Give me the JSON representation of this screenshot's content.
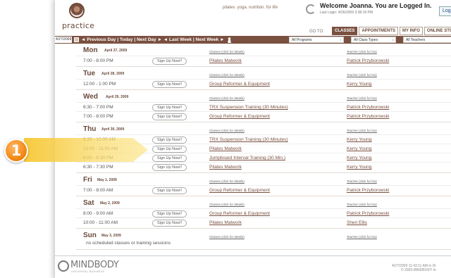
{
  "header": {
    "brand": "practice",
    "tagline": "pilates. yoga. nutrition. for life",
    "welcome": "Welcome Joanna. You are Logged In.",
    "last_login": "Last Login: 4/26/2009 3:38:19 PM",
    "logout_label": "Log Ou",
    "goto_label": "GO TO:",
    "nav_tabs": [
      "CLASSES",
      "APPOINTMENTS",
      "MY INFO",
      "ONLINE STOR"
    ]
  },
  "toolbar": {
    "date": "4/27/2009",
    "nav_text": "◄ Previous Day | Today | Next Day ► ◄ Last Week | Next Week ►",
    "program_filter": "All Programs",
    "class_type_filter": "All Class Types",
    "teacher_filter": "All Teachers"
  },
  "schedule": {
    "class_hint": "Classes (click for details)",
    "teacher_hint": "Teacher (click for bio)",
    "signup_label": "Sign Up Now!!",
    "days": [
      {
        "name": "Mon",
        "date": "April 27, 2009",
        "rows": [
          {
            "time": "7:00 - 8:00 PM",
            "class": "Pilates Matwork",
            "teacher": "Patrick Przyborowski"
          }
        ]
      },
      {
        "name": "Tue",
        "date": "April 28, 2009",
        "rows": [
          {
            "time": "12:00 - 1:00 PM",
            "class": "Group Reformer & Equipment",
            "teacher": "Kerry Young"
          }
        ]
      },
      {
        "name": "Wed",
        "date": "April 29, 2009",
        "rows": [
          {
            "time": "6:30 - 7:00 PM",
            "class": "TRX Suspension Training (30 Minutes)",
            "teacher": "Patrick Przyborowski"
          },
          {
            "time": "7:00 - 8:00 PM",
            "class": "Group Reformer & Equipment",
            "teacher": "Patrick Przyborowski"
          }
        ]
      },
      {
        "name": "Thu",
        "date": "April 30, 2009",
        "rows": [
          {
            "time": "6:30 - 10:00 AM",
            "class": "TRX Suspension Training (30 Minutes)",
            "teacher": "Kerry Young"
          },
          {
            "time": "10:00 - 11:00 AM",
            "class": "Pilates Matwork",
            "teacher": "Kerry Young"
          },
          {
            "time": "6:00 - 6:30 PM",
            "class": "Jumpboard Interval Training (30 Min.)",
            "teacher": "Kerry Young"
          },
          {
            "time": "6:30 - 7:30 PM",
            "class": "Pilates Matwork",
            "teacher": "Kerry Young"
          }
        ]
      },
      {
        "name": "Fri",
        "date": "May 1, 2009",
        "rows": [
          {
            "time": "7:00 - 8:00 AM",
            "class": "Group Reformer & Equipment",
            "teacher": "Patrick Przyborowski"
          }
        ]
      },
      {
        "name": "Sat",
        "date": "May 2, 2009",
        "rows": [
          {
            "time": "8:00 - 9:00 AM",
            "class": "Group Reformer & Equipment",
            "teacher": "Patrick Przyborowski"
          },
          {
            "time": "10:00 - 11:00 AM",
            "class": "Pilates Matwork",
            "teacher": "Sheri Ellis"
          }
        ]
      },
      {
        "name": "Sun",
        "date": "May 3, 2009",
        "note": "no scheduled classes or training sessions",
        "rows": []
      }
    ]
  },
  "footer": {
    "logo_text": "MINDBODY",
    "logo_sub": "UNIVERSAL BUSINESS",
    "timestamp_line1": "4/27/2009 11:43:11 AM in Dr",
    "timestamp_line2": "© 2009 MINDBODY In"
  },
  "callout": {
    "number": "1",
    "color": "#f28a16"
  }
}
